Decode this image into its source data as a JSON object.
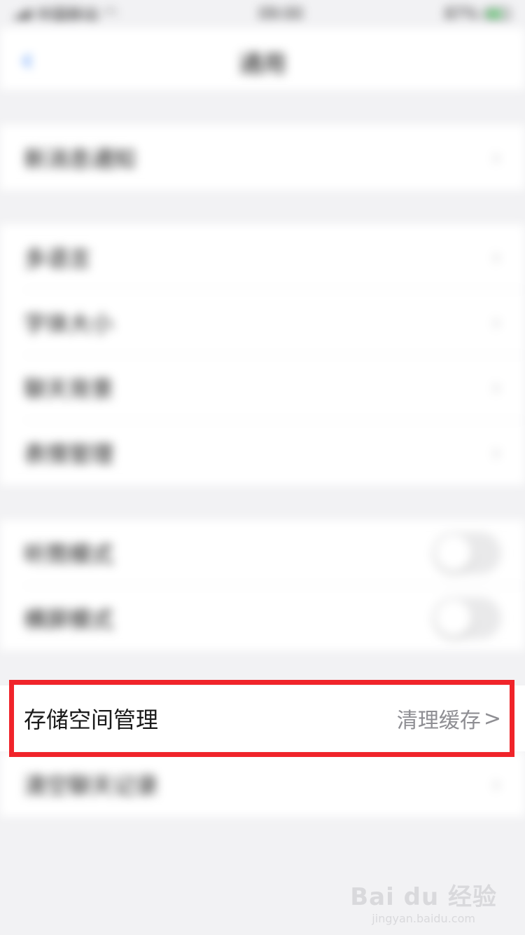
{
  "status_bar": {
    "carrier": "中国移动",
    "time": "09:00",
    "battery": "87%"
  },
  "nav": {
    "title": "通用",
    "back_icon": "chevron-left-icon"
  },
  "groups": [
    [
      {
        "label": "新消息通知",
        "control": "chevron"
      }
    ],
    [
      {
        "label": "多语言",
        "control": "chevron"
      },
      {
        "label": "字体大小",
        "control": "chevron"
      },
      {
        "label": "聊天背景",
        "control": "chevron"
      },
      {
        "label": "表情管理",
        "control": "chevron"
      }
    ],
    [
      {
        "label": "听筒模式",
        "control": "toggle"
      },
      {
        "label": "横屏模式",
        "control": "toggle"
      }
    ]
  ],
  "storage": {
    "label": "存储空间管理",
    "value": "清理缓存"
  },
  "after_storage": {
    "label": "清空聊天记录"
  },
  "watermark": {
    "logo": "Bai du 经验",
    "url": "jingyan.baidu.com"
  },
  "colors": {
    "highlight": "#f0242a",
    "accent": "#2f7cf6"
  }
}
